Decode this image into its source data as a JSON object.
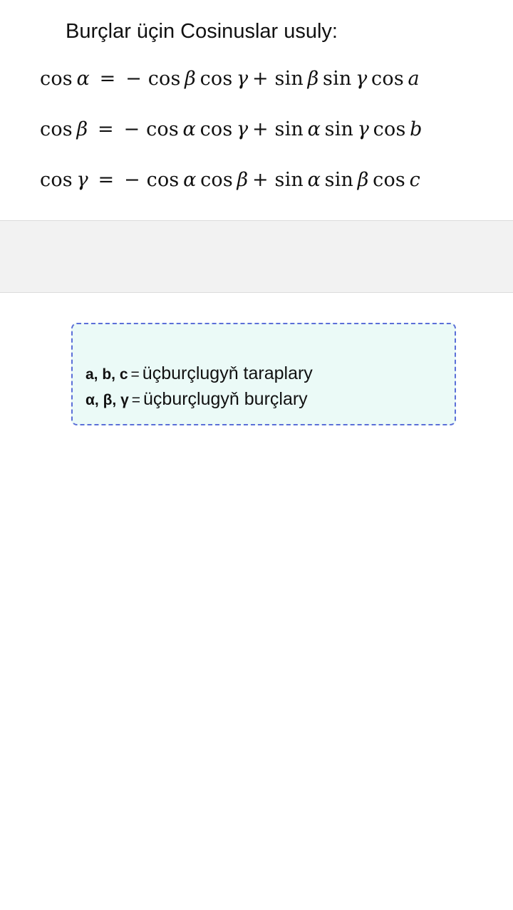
{
  "title": "Burçlar üçin Cosinuslar usuly:",
  "formulas": [
    {
      "lhs_fn": "cos",
      "lhs_var": "α",
      "eq": "=",
      "t1": "− cos",
      "v1": "β",
      "t2": "cos",
      "v2": "γ",
      "t3": "+ sin",
      "v3": "β",
      "t4": "sin",
      "v4": "γ",
      "t5": "cos",
      "v5": "a"
    },
    {
      "lhs_fn": "cos",
      "lhs_var": "β",
      "eq": "=",
      "t1": "− cos",
      "v1": "α",
      "t2": "cos",
      "v2": "γ",
      "t3": "+ sin",
      "v3": "α",
      "t4": "sin",
      "v4": "γ",
      "t5": "cos",
      "v5": "b"
    },
    {
      "lhs_fn": "cos",
      "lhs_var": "γ",
      "eq": "=",
      "t1": "− cos",
      "v1": "α",
      "t2": "cos",
      "v2": "β",
      "t3": "+ sin",
      "v3": "α",
      "t4": "sin",
      "v4": "β",
      "t5": "cos",
      "v5": "c"
    }
  ],
  "legend": {
    "rows": [
      {
        "key": "a, b, c",
        "eq": "=",
        "desc": "üçburçlugyň taraplary"
      },
      {
        "key": "α, β, γ",
        "eq": "=",
        "desc": "üçburçlugyň burçlary"
      }
    ]
  },
  "colors": {
    "legend_border": "#5b6fd8",
    "legend_background": "#ebfaf7",
    "band_background": "#f2f2f2"
  }
}
